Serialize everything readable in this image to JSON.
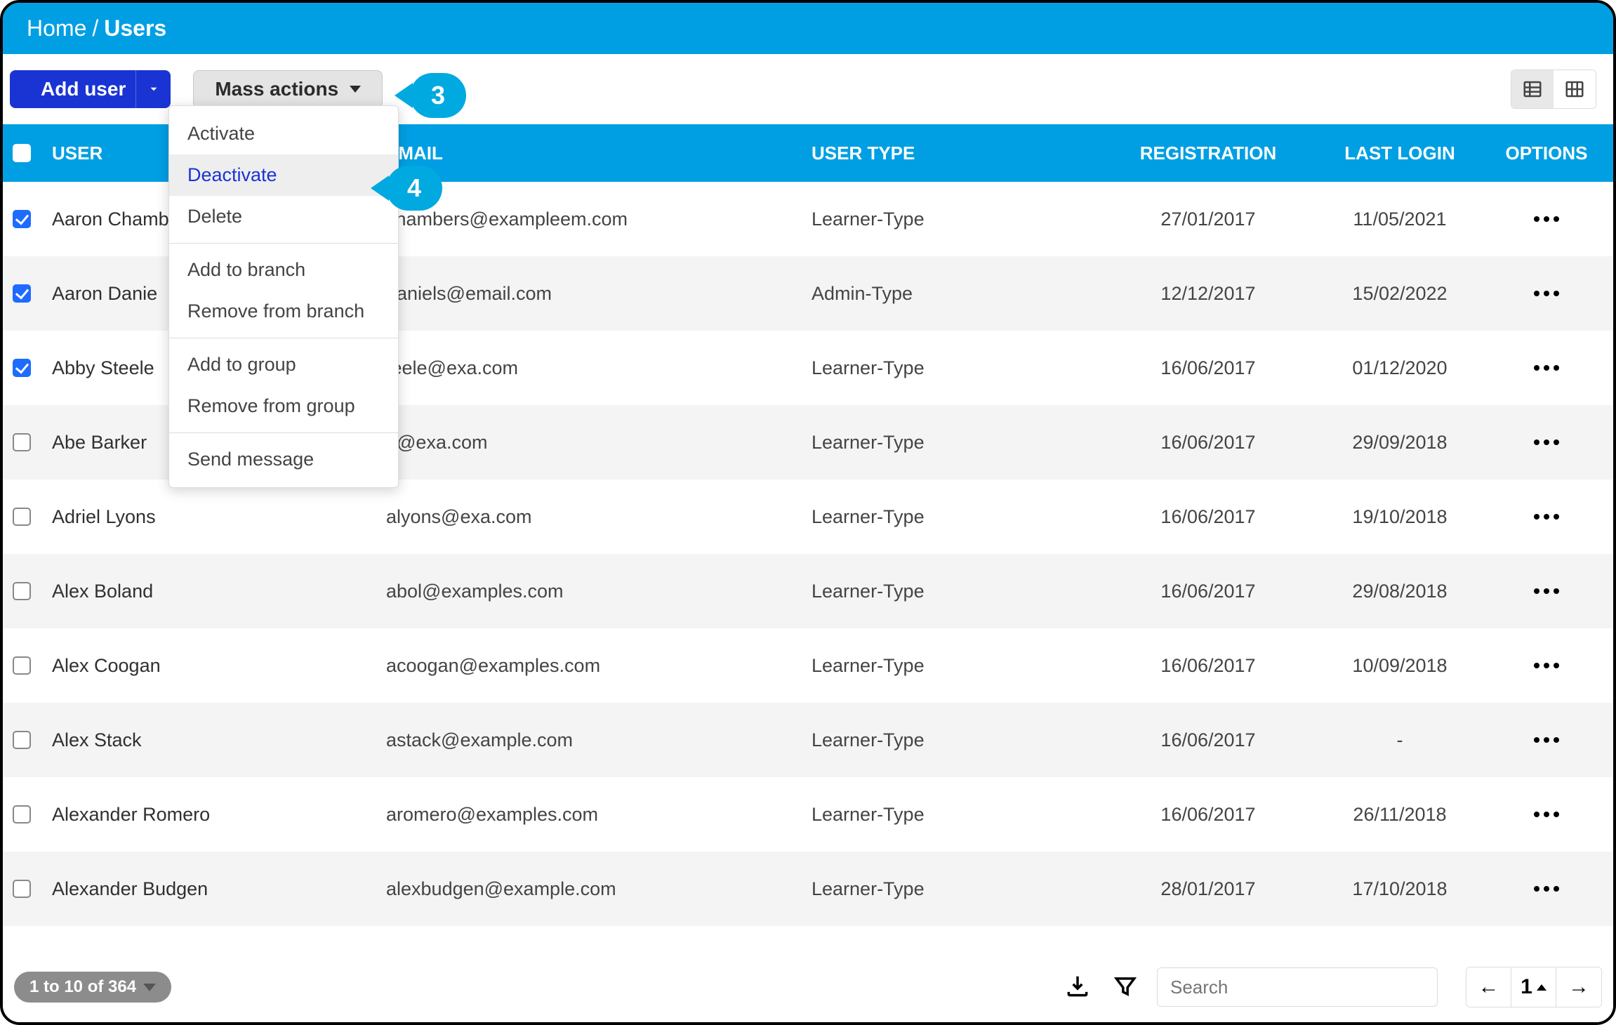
{
  "breadcrumb": {
    "home": "Home",
    "sep": "/",
    "page": "Users"
  },
  "toolbar": {
    "add_user": "Add user",
    "mass_actions": "Mass actions"
  },
  "dropdown": {
    "activate": "Activate",
    "deactivate": "Deactivate",
    "delete": "Delete",
    "add_branch": "Add to branch",
    "remove_branch": "Remove from branch",
    "add_group": "Add to group",
    "remove_group": "Remove from group",
    "send_message": "Send message"
  },
  "callouts": {
    "three": "3",
    "four": "4"
  },
  "columns": {
    "user": "USER",
    "email": "EMAIL",
    "type": "USER TYPE",
    "registration": "REGISTRATION",
    "last_login": "LAST LOGIN",
    "options": "OPTIONS"
  },
  "rows": [
    {
      "checked": true,
      "name": "Aaron Chambers",
      "name_visible": "Aaron Chamb",
      "email": "chambers@exampleem.com",
      "type": "Learner-Type",
      "registration": "27/01/2017",
      "last_login": "11/05/2021"
    },
    {
      "checked": true,
      "name": "Aaron Daniels",
      "name_visible": "Aaron Danie",
      "email": "daniels@email.com",
      "type": "Admin-Type",
      "registration": "12/12/2017",
      "last_login": "15/02/2022"
    },
    {
      "checked": true,
      "name": "Abby Steele",
      "name_visible": "Abby Steele",
      "email": "teele@exa.com",
      "type": "Learner-Type",
      "registration": "16/06/2017",
      "last_login": "01/12/2020"
    },
    {
      "checked": false,
      "name": "Abe Barker",
      "name_visible": "Abe Barker",
      "email": "e@exa.com",
      "type": "Learner-Type",
      "registration": "16/06/2017",
      "last_login": "29/09/2018"
    },
    {
      "checked": false,
      "name": "Adriel Lyons",
      "name_visible": "Adriel Lyons",
      "email": "alyons@exa.com",
      "type": "Learner-Type",
      "registration": "16/06/2017",
      "last_login": "19/10/2018"
    },
    {
      "checked": false,
      "name": "Alex Boland",
      "name_visible": "Alex Boland",
      "email": "abol@examples.com",
      "type": "Learner-Type",
      "registration": "16/06/2017",
      "last_login": "29/08/2018"
    },
    {
      "checked": false,
      "name": "Alex Coogan",
      "name_visible": "Alex Coogan",
      "email": "acoogan@examples.com",
      "type": "Learner-Type",
      "registration": "16/06/2017",
      "last_login": "10/09/2018"
    },
    {
      "checked": false,
      "name": "Alex Stack",
      "name_visible": "Alex Stack",
      "email": "astack@example.com",
      "type": "Learner-Type",
      "registration": "16/06/2017",
      "last_login": "-"
    },
    {
      "checked": false,
      "name": "Alexander Romero",
      "name_visible": "Alexander Romero",
      "email": "aromero@examples.com",
      "type": "Learner-Type",
      "registration": "16/06/2017",
      "last_login": "26/11/2018"
    },
    {
      "checked": false,
      "name": "Alexander Budgen",
      "name_visible": "Alexander Budgen",
      "email": "alexbudgen@example.com",
      "type": "Learner-Type",
      "registration": "28/01/2017",
      "last_login": "17/10/2018"
    }
  ],
  "footer": {
    "range": "1 to 10 of 364",
    "search_placeholder": "Search",
    "prev": "←",
    "page": "1",
    "next": "→"
  }
}
